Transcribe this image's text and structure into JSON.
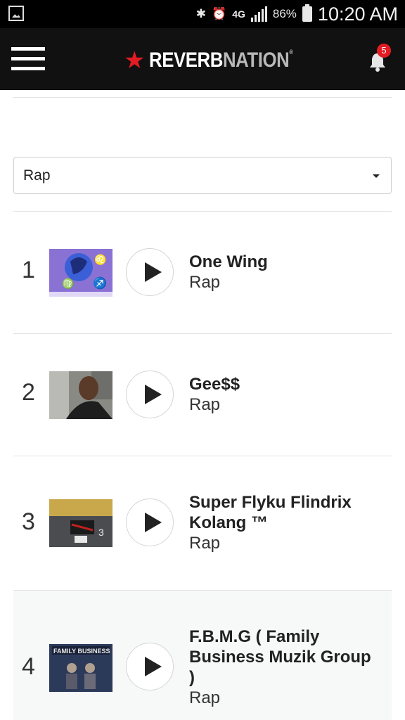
{
  "status_bar": {
    "network": "4G",
    "battery": "86%",
    "time": "10:20 AM"
  },
  "app_bar": {
    "logo_part1": "REVERB",
    "logo_part2": "NATION",
    "notification_count": "5"
  },
  "filter": {
    "selected": "Rap"
  },
  "tracks": [
    {
      "rank": "1",
      "title": "One Wing",
      "genre": "Rap"
    },
    {
      "rank": "2",
      "title": "Gee$$",
      "genre": "Rap"
    },
    {
      "rank": "3",
      "title": "Super Flyku Flindrix Kolang ™",
      "genre": "Rap"
    },
    {
      "rank": "4",
      "title": "F.B.M.G ( Family Business Muzik Group )",
      "genre": "Rap"
    }
  ],
  "colors": {
    "brand_red": "#e31c23",
    "app_bar": "#111111"
  }
}
